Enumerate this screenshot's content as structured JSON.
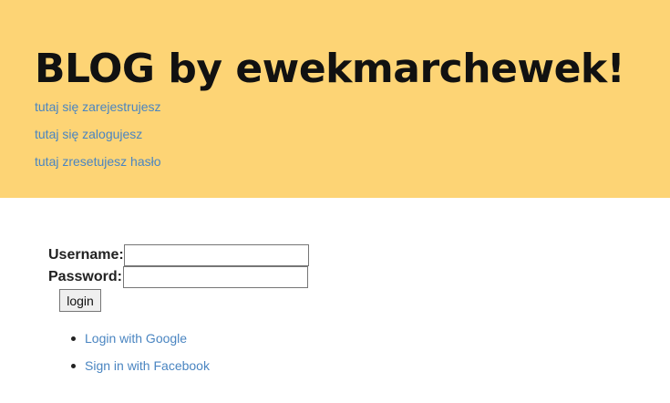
{
  "header": {
    "title": "BLOG by ewekmarchewek!",
    "links": {
      "register": "tutaj się zarejestrujesz",
      "login": "tutaj się zalogujesz",
      "reset_password": "tutaj zresetujesz hasło"
    }
  },
  "login_form": {
    "username_label": "Username:",
    "username_value": "",
    "password_label": "Password:",
    "password_value": "",
    "submit_label": "login"
  },
  "social_login": {
    "google_label": "Login with Google",
    "facebook_label": "Sign in with Facebook"
  },
  "colors": {
    "header_background": "#fdd475",
    "link": "#4a85c1"
  }
}
